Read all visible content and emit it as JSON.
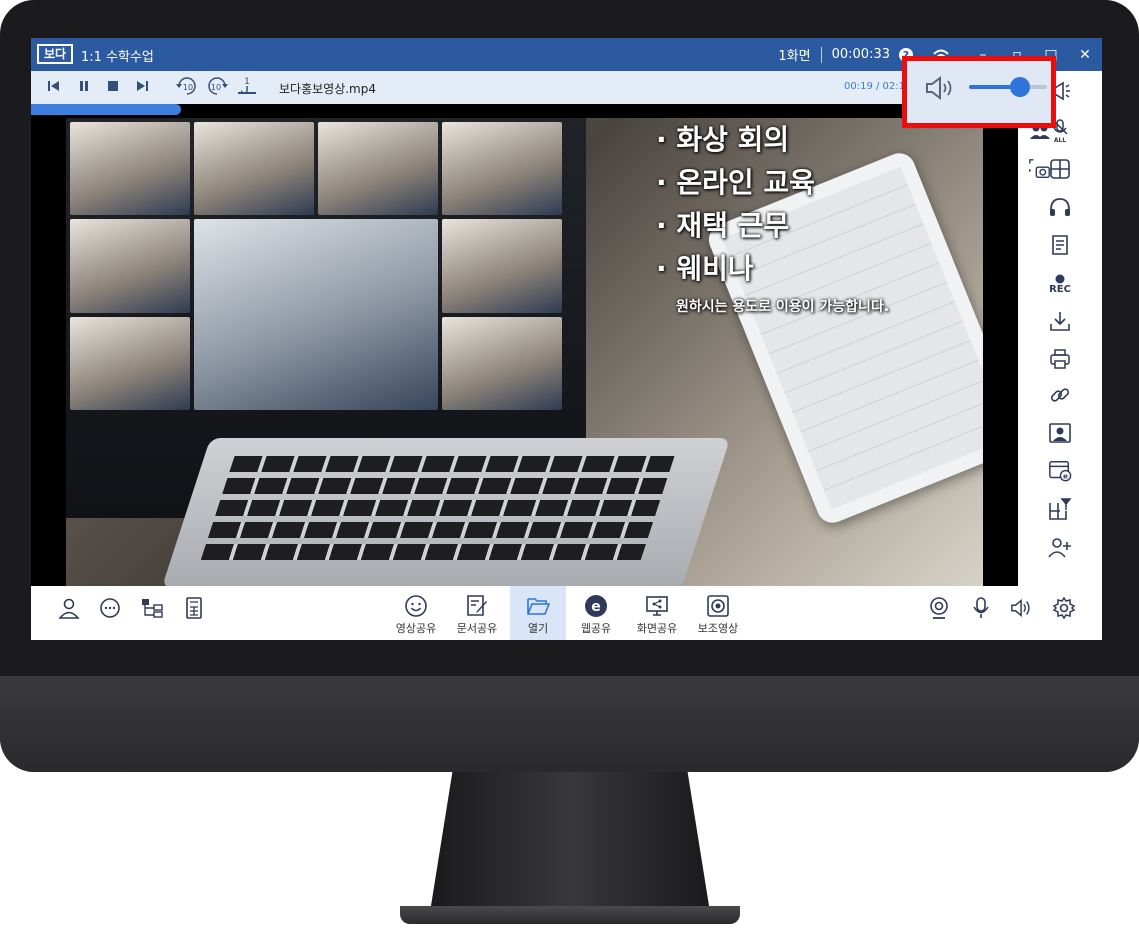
{
  "titlebar": {
    "logo": "보다",
    "title": "1:1 수학수업",
    "screen_count": "1화면",
    "elapsed": "00:00:33"
  },
  "player": {
    "filename": "보다홍보영상.mp4",
    "time": "00:19 / 02:1",
    "rewind_label": "10",
    "forward_label": "10",
    "speed_label": "1",
    "progress_fraction": 0.14
  },
  "volume": {
    "level_fraction": 0.65
  },
  "video": {
    "bullets": [
      "· 화상 회의",
      "· 온라인 교육",
      "· 재택 근무",
      "· 웨비나"
    ],
    "subtitle": "원하시는 용도로 이용이 가능합니다."
  },
  "right_toolbar": {
    "icons": [
      "megaphone-icon",
      "participants-icon",
      "mute-all-icon",
      "screen-capture-icon",
      "layout-grid-icon",
      "headset-icon",
      "document-icon",
      "record-icon",
      "download-icon",
      "print-icon",
      "link-icon",
      "portrait-icon",
      "web-window-icon",
      "pin-layout-icon",
      "add-user-icon"
    ],
    "rec_label": "REC",
    "mute_all_label": "ALL"
  },
  "bottom_toolbar": {
    "left_icons": [
      "user-icon",
      "chat-icon",
      "tree-icon",
      "calculator-icon"
    ],
    "center": [
      {
        "label": "영상공유",
        "icon": "smile-icon"
      },
      {
        "label": "문서공유",
        "icon": "document-share-icon"
      },
      {
        "label": "열기",
        "icon": "folder-open-icon"
      },
      {
        "label": "웹공유",
        "icon": "web-share-icon"
      },
      {
        "label": "화면공유",
        "icon": "screen-share-icon"
      },
      {
        "label": "보조영상",
        "icon": "aux-video-icon"
      }
    ],
    "right_icons": [
      "webcam-icon",
      "microphone-icon",
      "speaker-icon",
      "settings-icon"
    ]
  },
  "colors": {
    "titlebar": "#2c5aa0",
    "accent": "#3d7fe0",
    "highlight": "#ec0d0d"
  }
}
